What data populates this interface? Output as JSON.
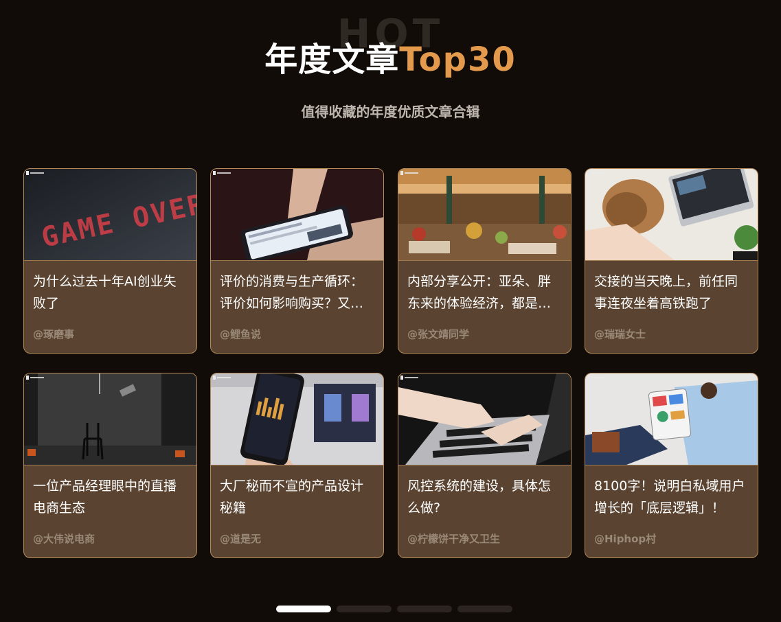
{
  "hero": {
    "bg_word": "HOT",
    "title_cn": "年度文章",
    "title_en": "Top30",
    "subtitle": "值得收藏的年度优质文章合辑"
  },
  "colors": {
    "background": "#120c08",
    "card": "#5a4330",
    "card_border": "#b48c59",
    "accent": "#e39a4d",
    "author": "#9a8978"
  },
  "cards": [
    {
      "title": "为什么过去十年AI创业失败了",
      "author": "@琢磨事",
      "image": "game-over-sign"
    },
    {
      "title": "评价的消费与生产循环：评价如何影响购买？又如何被生产？",
      "author": "@鲤鱼说",
      "image": "hands-holding-phone"
    },
    {
      "title": "内部分享公开：亚朵、胖东来的体验经济，都是怎么做的？",
      "author": "@张文靖同学",
      "image": "market-stalls"
    },
    {
      "title": "交接的当天晚上，前任同事连夜坐着高铁跑了",
      "author": "@瑞瑞女士",
      "image": "stressed-person-laptop"
    },
    {
      "title": "一位产品经理眼中的直播电商生态",
      "author": "@大伟说电商",
      "image": "studio-chair"
    },
    {
      "title": "大厂秘而不宣的产品设计秘籍",
      "author": "@道是无",
      "image": "phone-finance-app"
    },
    {
      "title": "风控系统的建设，具体怎么做?",
      "author": "@柠檬饼干净又卫生",
      "image": "typing-on-laptop"
    },
    {
      "title": "8100字！说明白私域用户增长的「底层逻辑」！",
      "author": "@Hiphop村",
      "image": "tablet-charts"
    }
  ],
  "pagination": {
    "count": 4,
    "active": 1
  }
}
